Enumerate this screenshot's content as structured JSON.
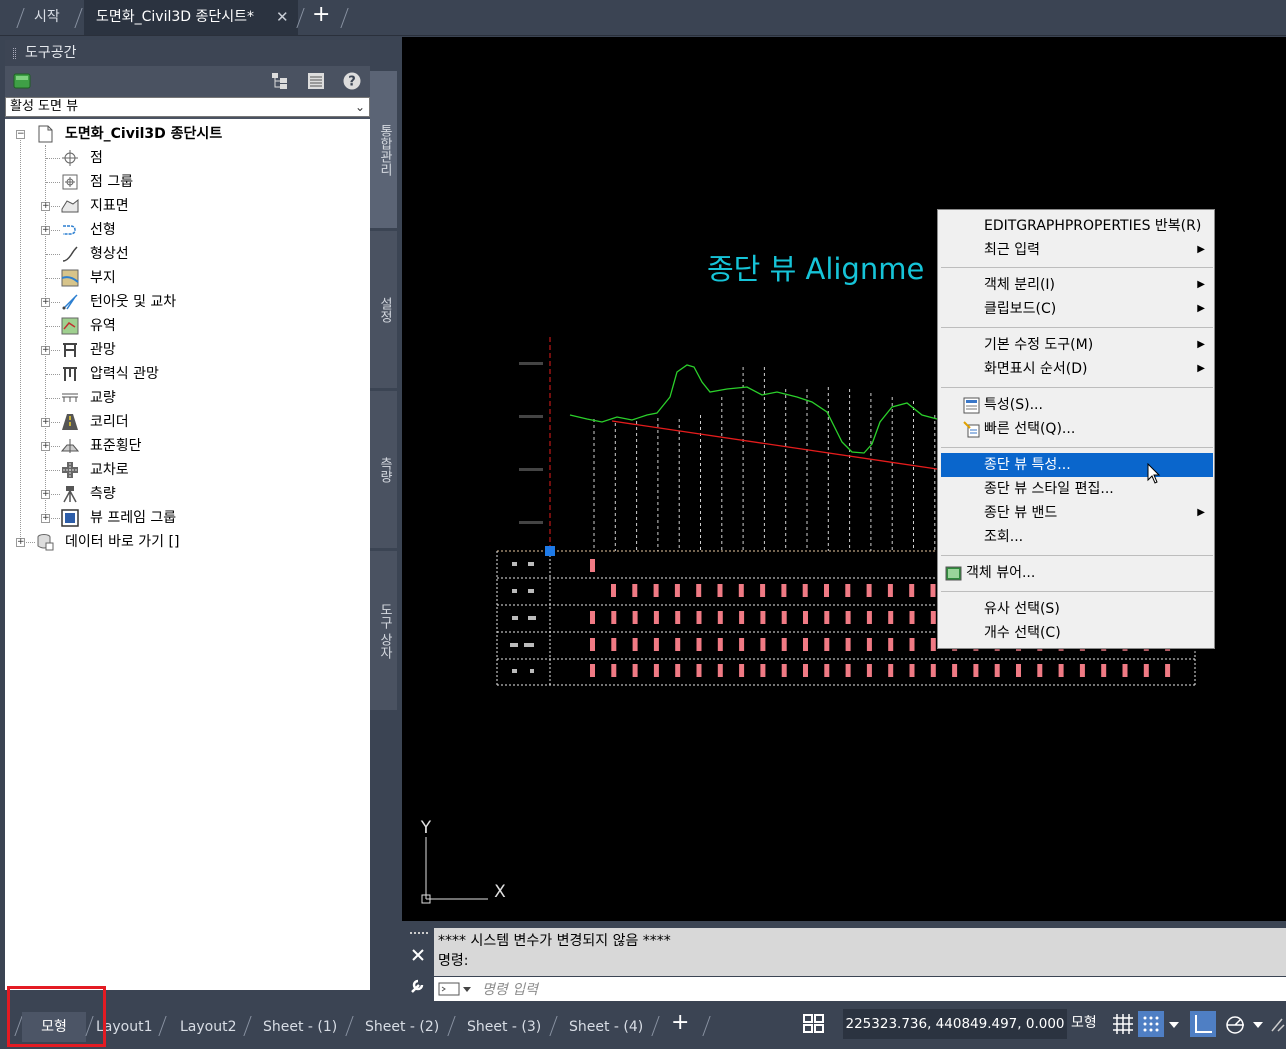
{
  "file_tabs": {
    "start": "시작",
    "active": "도면화_Civil3D 종단시트*",
    "close_symbol": "✕",
    "add_symbol": "+"
  },
  "toolspace": {
    "title": "도구공간",
    "dropdown_value": "활성 도면 뷰",
    "toolbar_icons": [
      "civil-3d-icon",
      "hierarchy-icon",
      "item-view-icon",
      "help-icon"
    ],
    "tree": {
      "root": "도면화_Civil3D 종단시트",
      "items": [
        "점",
        "점 그룹",
        "지표면",
        "선형",
        "형상선",
        "부지",
        "턴아웃 및 교차",
        "유역",
        "관망",
        "압력식 관망",
        "교량",
        "코리더",
        "표준횡단",
        "교차로",
        "측량",
        "뷰 프레임 그룹"
      ],
      "data_shortcuts": "데이터 바로 가기 []"
    },
    "side_tabs": [
      "통합관리",
      "설정",
      "측량",
      "도구 상자"
    ]
  },
  "drawing": {
    "title": "종단 뷰  Alignme",
    "axis_y_label": "Y",
    "axis_x_label": "X",
    "colors": {
      "title": "#16c4d8",
      "ground_line": "#2bd02b",
      "design_line": "#e41c1c",
      "band_marks": "#f07a84"
    }
  },
  "context_menu": {
    "items": [
      {
        "label": "EDITGRAPHPROPERTIES 반복(R)",
        "submenu": false
      },
      {
        "label": "최근 입력",
        "submenu": true
      },
      {
        "label": "객체 분리(I)",
        "submenu": true
      },
      {
        "label": "클립보드(C)",
        "submenu": true
      },
      {
        "label": "기본 수정 도구(M)",
        "submenu": true
      },
      {
        "label": "화면표시 순서(D)",
        "submenu": true
      },
      {
        "label": "특성(S)...",
        "submenu": false
      },
      {
        "label": "빠른 선택(Q)...",
        "submenu": false
      },
      {
        "label": "종단 뷰 특성...",
        "submenu": false,
        "highlighted": true
      },
      {
        "label": "종단 뷰 스타일 편집...",
        "submenu": false
      },
      {
        "label": "종단 뷰 밴드",
        "submenu": true
      },
      {
        "label": "조회...",
        "submenu": false
      },
      {
        "label": "객체 뷰어...",
        "submenu": false
      },
      {
        "label": "유사 선택(S)",
        "submenu": false
      },
      {
        "label": "개수 선택(C)",
        "submenu": false
      }
    ]
  },
  "command_line": {
    "history_line1": "**** 시스템 변수가 변경되지 않음 ****",
    "history_line2": "명령:",
    "placeholder": "명령 입력"
  },
  "layout_tabs": [
    "모형",
    "Layout1",
    "Layout2",
    "Sheet - (1)",
    "Sheet - (2)",
    "Sheet - (3)",
    "Sheet - (4)"
  ],
  "status": {
    "coordinates": "225323.736, 440849.497, 0.000",
    "model_button": "모형",
    "highlight_color": "#e31b23"
  }
}
